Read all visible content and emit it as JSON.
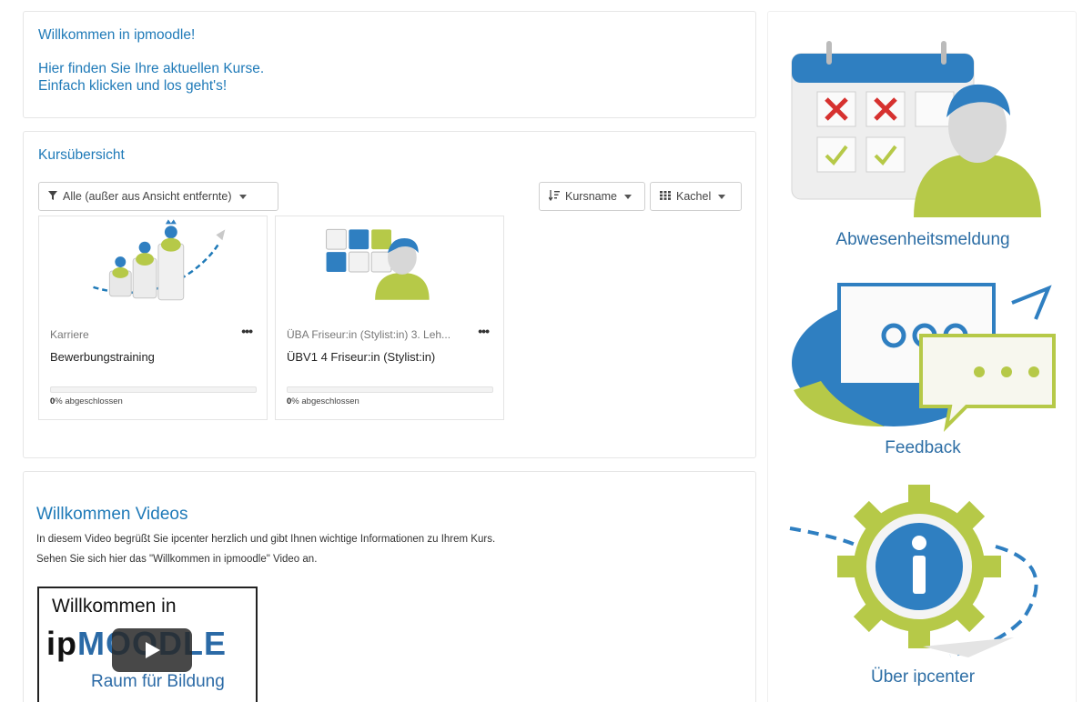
{
  "welcome": {
    "title": "Willkommen in ipmoodle!",
    "line1": "Hier finden Sie Ihre aktuellen Kurse.",
    "line2": "Einfach klicken und los geht's!"
  },
  "overview": {
    "title": "Kursübersicht",
    "filter_label": "Alle (außer aus Ansicht entfernte)",
    "sort_label": "Kursname",
    "view_label": "Kachel",
    "courses": [
      {
        "category": "Karriere",
        "name": "Bewerbungstraining",
        "progress_percent": 0,
        "progress_value": "0",
        "progress_suffix": "% abgeschlossen"
      },
      {
        "category": "ÜBA Friseur:in (Stylist:in) 3. Leh...",
        "name": "ÜBV1 4 Friseur:in (Stylist:in)",
        "progress_percent": 0,
        "progress_value": "0",
        "progress_suffix": "% abgeschlossen"
      }
    ]
  },
  "videos": {
    "title": "Willkommen Videos",
    "desc1": "In diesem Video begrüßt Sie ipcenter herzlich und gibt Ihnen wichtige Informationen zu Ihrem Kurs.",
    "desc2": "Sehen Sie sich hier das \"Willkommen in ipmoodle\" Video an.",
    "thumb_title": "Willkommen in",
    "thumb_logo": "ipMOODLE",
    "thumb_sub": "Raum für Bildung"
  },
  "side": {
    "link1": "Abwesenheitsmeldung",
    "link2": "Feedback",
    "link3": "Über ipcenter"
  },
  "colors": {
    "accent": "#1f7ab8",
    "lime": "#b6c948",
    "side_text": "#2d6ea5"
  }
}
